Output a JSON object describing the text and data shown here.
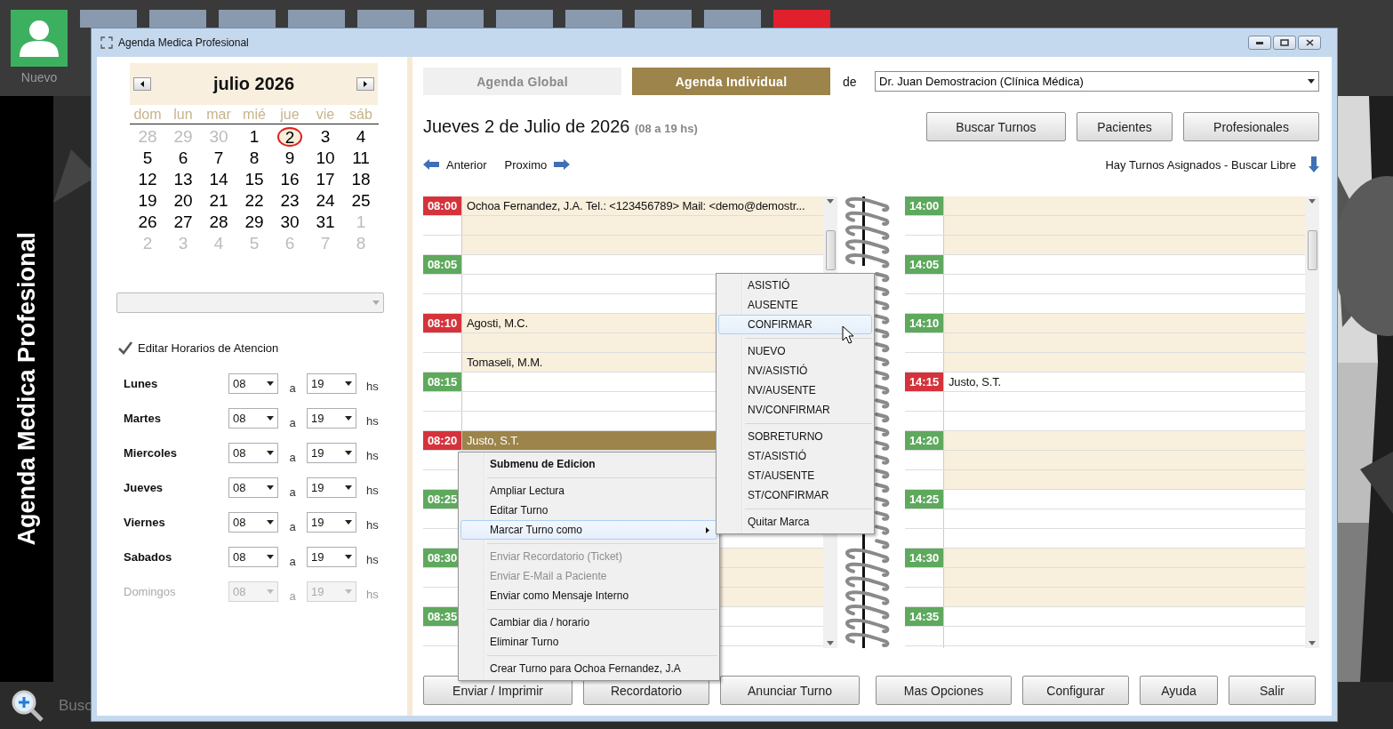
{
  "desktop": {
    "tiles": [
      {
        "kind": "user",
        "label": "Nuevo"
      },
      {
        "kind": "app"
      },
      {
        "kind": "app"
      },
      {
        "kind": "app"
      },
      {
        "kind": "app"
      },
      {
        "kind": "app"
      },
      {
        "kind": "app"
      },
      {
        "kind": "app"
      },
      {
        "kind": "app"
      },
      {
        "kind": "app"
      },
      {
        "kind": "app"
      },
      {
        "kind": "exit"
      }
    ],
    "side_title": "Agenda Medica Profesional",
    "search_label": "Busc"
  },
  "window": {
    "title": "Agenda Medica Profesional"
  },
  "calendar": {
    "month": "julio 2026",
    "weekdays": [
      "dom",
      "lun",
      "mar",
      "mié",
      "jue",
      "vie",
      "sáb"
    ],
    "weeks": [
      [
        {
          "day": "28",
          "outside": true,
          "selected": false
        },
        {
          "day": "29",
          "outside": true,
          "selected": false
        },
        {
          "day": "30",
          "outside": true,
          "selected": false
        },
        {
          "day": "1",
          "outside": false,
          "selected": false
        },
        {
          "day": "2",
          "outside": false,
          "selected": true
        },
        {
          "day": "3",
          "outside": false,
          "selected": false
        },
        {
          "day": "4",
          "outside": false,
          "selected": false
        }
      ],
      [
        {
          "day": "5",
          "outside": false,
          "selected": false
        },
        {
          "day": "6",
          "outside": false,
          "selected": false
        },
        {
          "day": "7",
          "outside": false,
          "selected": false
        },
        {
          "day": "8",
          "outside": false,
          "selected": false
        },
        {
          "day": "9",
          "outside": false,
          "selected": false
        },
        {
          "day": "10",
          "outside": false,
          "selected": false
        },
        {
          "day": "11",
          "outside": false,
          "selected": false
        }
      ],
      [
        {
          "day": "12",
          "outside": false,
          "selected": false
        },
        {
          "day": "13",
          "outside": false,
          "selected": false
        },
        {
          "day": "14",
          "outside": false,
          "selected": false
        },
        {
          "day": "15",
          "outside": false,
          "selected": false
        },
        {
          "day": "16",
          "outside": false,
          "selected": false
        },
        {
          "day": "17",
          "outside": false,
          "selected": false
        },
        {
          "day": "18",
          "outside": false,
          "selected": false
        }
      ],
      [
        {
          "day": "19",
          "outside": false,
          "selected": false
        },
        {
          "day": "20",
          "outside": false,
          "selected": false
        },
        {
          "day": "21",
          "outside": false,
          "selected": false
        },
        {
          "day": "22",
          "outside": false,
          "selected": false
        },
        {
          "day": "23",
          "outside": false,
          "selected": false
        },
        {
          "day": "24",
          "outside": false,
          "selected": false
        },
        {
          "day": "25",
          "outside": false,
          "selected": false
        }
      ],
      [
        {
          "day": "26",
          "outside": false,
          "selected": false
        },
        {
          "day": "27",
          "outside": false,
          "selected": false
        },
        {
          "day": "28",
          "outside": false,
          "selected": false
        },
        {
          "day": "29",
          "outside": false,
          "selected": false
        },
        {
          "day": "30",
          "outside": false,
          "selected": false
        },
        {
          "day": "31",
          "outside": false,
          "selected": false
        },
        {
          "day": "1",
          "outside": true,
          "selected": false
        }
      ],
      [
        {
          "day": "2",
          "outside": true,
          "selected": false
        },
        {
          "day": "3",
          "outside": true,
          "selected": false
        },
        {
          "day": "4",
          "outside": true,
          "selected": false
        },
        {
          "day": "5",
          "outside": true,
          "selected": false
        },
        {
          "day": "6",
          "outside": true,
          "selected": false
        },
        {
          "day": "7",
          "outside": true,
          "selected": false
        },
        {
          "day": "8",
          "outside": true,
          "selected": false
        }
      ]
    ]
  },
  "hours": {
    "label": "Editar Horarios de Atencion",
    "checked": true,
    "days": [
      {
        "day": "Lunes",
        "from": "08",
        "joiner": "a",
        "to": "19",
        "unit": "hs",
        "disabled": false
      },
      {
        "day": "Martes",
        "from": "08",
        "joiner": "a",
        "to": "19",
        "unit": "hs",
        "disabled": false
      },
      {
        "day": "Miercoles",
        "from": "08",
        "joiner": "a",
        "to": "19",
        "unit": "hs",
        "disabled": false
      },
      {
        "day": "Jueves",
        "from": "08",
        "joiner": "a",
        "to": "19",
        "unit": "hs",
        "disabled": false
      },
      {
        "day": "Viernes",
        "from": "08",
        "joiner": "a",
        "to": "19",
        "unit": "hs",
        "disabled": false
      },
      {
        "day": "Sabados",
        "from": "08",
        "joiner": "a",
        "to": "19",
        "unit": "hs",
        "disabled": false
      },
      {
        "day": "Domingos",
        "from": "08",
        "joiner": "a",
        "to": "19",
        "unit": "hs",
        "disabled": true
      }
    ]
  },
  "tabs": [
    {
      "label": "Agenda Global",
      "selected": false
    },
    {
      "label": "Agenda Individual",
      "selected": true
    }
  ],
  "professional": {
    "prefix": "de",
    "value": "Dr. Juan Demostracion (Clínica Médica)"
  },
  "day_title": {
    "date": "Jueves 2 de Julio de 2026",
    "hours": "(08 a 19 hs)"
  },
  "top_buttons": [
    "Buscar Turnos",
    "Pacientes",
    "Profesionales"
  ],
  "nav": {
    "previous": "Anterior",
    "next": "Proximo",
    "hint": "Hay Turnos Asignados - Buscar Libre"
  },
  "agenda": [
    {
      "slots": [
        {
          "time": "08:00",
          "occupied": true,
          "rows": [
            {
              "kind": "entry",
              "text": "Ochoa Fernandez, J.A. Tel.: <123456789> Mail: <demo@demostr...",
              "selected": false
            },
            {
              "kind": "empty"
            },
            {
              "kind": "empty"
            }
          ]
        },
        {
          "time": "08:05",
          "occupied": false,
          "rows": [
            {
              "kind": "empty"
            },
            {
              "kind": "empty"
            },
            {
              "kind": "empty"
            }
          ]
        },
        {
          "time": "08:10",
          "occupied": true,
          "rows": [
            {
              "kind": "entry",
              "text": "Agosti, M.C.",
              "selected": false
            },
            {
              "kind": "empty"
            },
            {
              "kind": "entry",
              "text": "Tomaseli, M.M.",
              "selected": false
            }
          ]
        },
        {
          "time": "08:15",
          "occupied": false,
          "rows": [
            {
              "kind": "empty"
            },
            {
              "kind": "empty"
            },
            {
              "kind": "empty"
            }
          ]
        },
        {
          "time": "08:20",
          "occupied": true,
          "rows": [
            {
              "kind": "entry",
              "text": "Justo, S.T.",
              "selected": true
            },
            {
              "kind": "empty"
            },
            {
              "kind": "empty"
            }
          ]
        },
        {
          "time": "08:25",
          "occupied": false,
          "rows": [
            {
              "kind": "empty"
            },
            {
              "kind": "empty"
            },
            {
              "kind": "empty"
            }
          ]
        },
        {
          "time": "08:30",
          "occupied": false,
          "rows": [
            {
              "kind": "empty"
            },
            {
              "kind": "empty"
            },
            {
              "kind": "empty"
            }
          ]
        },
        {
          "time": "08:35",
          "occupied": false,
          "rows": [
            {
              "kind": "empty"
            },
            {
              "kind": "empty"
            },
            {
              "kind": "empty"
            }
          ]
        }
      ]
    },
    {
      "slots": [
        {
          "time": "14:00",
          "occupied": false,
          "rows": [
            {
              "kind": "empty"
            },
            {
              "kind": "empty"
            },
            {
              "kind": "empty"
            }
          ]
        },
        {
          "time": "14:05",
          "occupied": false,
          "rows": [
            {
              "kind": "empty"
            },
            {
              "kind": "empty"
            },
            {
              "kind": "empty"
            }
          ]
        },
        {
          "time": "14:10",
          "occupied": false,
          "rows": [
            {
              "kind": "empty"
            },
            {
              "kind": "empty"
            },
            {
              "kind": "empty"
            }
          ]
        },
        {
          "time": "14:15",
          "occupied": true,
          "rows": [
            {
              "kind": "entry",
              "text": "Justo, S.T.",
              "selected": false
            },
            {
              "kind": "empty"
            },
            {
              "kind": "empty"
            }
          ]
        },
        {
          "time": "14:20",
          "occupied": false,
          "rows": [
            {
              "kind": "empty"
            },
            {
              "kind": "empty"
            },
            {
              "kind": "empty"
            }
          ]
        },
        {
          "time": "14:25",
          "occupied": false,
          "rows": [
            {
              "kind": "empty"
            },
            {
              "kind": "empty"
            },
            {
              "kind": "empty"
            }
          ]
        },
        {
          "time": "14:30",
          "occupied": false,
          "rows": [
            {
              "kind": "empty"
            },
            {
              "kind": "empty"
            },
            {
              "kind": "empty"
            }
          ]
        },
        {
          "time": "14:35",
          "occupied": false,
          "rows": [
            {
              "kind": "empty"
            },
            {
              "kind": "empty"
            },
            {
              "kind": "empty"
            }
          ]
        }
      ]
    }
  ],
  "context_menu": [
    {
      "kind": "header",
      "label": "Submenu de Edicion"
    },
    {
      "kind": "separator"
    },
    {
      "kind": "item",
      "label": "Ampliar Lectura",
      "disabled": false,
      "selected": false
    },
    {
      "kind": "item",
      "label": "Editar Turno",
      "disabled": false,
      "selected": false
    },
    {
      "kind": "submenu",
      "label": "Marcar Turno como",
      "disabled": false,
      "selected": true
    },
    {
      "kind": "separator"
    },
    {
      "kind": "item",
      "label": "Enviar Recordatorio (Ticket)",
      "disabled": true,
      "selected": false
    },
    {
      "kind": "item",
      "label": "Enviar E-Mail a Paciente",
      "disabled": true,
      "selected": false
    },
    {
      "kind": "item",
      "label": "Enviar como Mensaje Interno",
      "disabled": false,
      "selected": false
    },
    {
      "kind": "separator"
    },
    {
      "kind": "item",
      "label": "Cambiar dia / horario",
      "disabled": false,
      "selected": false
    },
    {
      "kind": "item",
      "label": "Eliminar Turno",
      "disabled": false,
      "selected": false
    },
    {
      "kind": "separator"
    },
    {
      "kind": "item",
      "label": "Crear Turno para Ochoa Fernandez, J.A",
      "disabled": false,
      "selected": false
    }
  ],
  "submenu": [
    {
      "kind": "item",
      "label": "ASISTIÓ",
      "disabled": false,
      "selected": false
    },
    {
      "kind": "item",
      "label": "AUSENTE",
      "disabled": false,
      "selected": false
    },
    {
      "kind": "item",
      "label": "CONFIRMAR",
      "disabled": false,
      "selected": true
    },
    {
      "kind": "separator"
    },
    {
      "kind": "item",
      "label": "NUEVO",
      "disabled": false,
      "selected": false
    },
    {
      "kind": "item",
      "label": "NV/ASISTIÓ",
      "disabled": false,
      "selected": false
    },
    {
      "kind": "item",
      "label": "NV/AUSENTE",
      "disabled": false,
      "selected": false
    },
    {
      "kind": "item",
      "label": "NV/CONFIRMAR",
      "disabled": false,
      "selected": false
    },
    {
      "kind": "separator"
    },
    {
      "kind": "item",
      "label": "SOBRETURNO",
      "disabled": false,
      "selected": false
    },
    {
      "kind": "item",
      "label": "ST/ASISTIÓ",
      "disabled": false,
      "selected": false
    },
    {
      "kind": "item",
      "label": "ST/AUSENTE",
      "disabled": false,
      "selected": false
    },
    {
      "kind": "item",
      "label": "ST/CONFIRMAR",
      "disabled": false,
      "selected": false
    },
    {
      "kind": "separator"
    },
    {
      "kind": "item",
      "label": "Quitar Marca",
      "disabled": false,
      "selected": false
    }
  ],
  "bottom_buttons": [
    "Enviar / Imprimir",
    "Recordatorio",
    "Anunciar Turno",
    "Mas Opciones",
    "Configurar",
    "Ayuda",
    "Salir"
  ]
}
